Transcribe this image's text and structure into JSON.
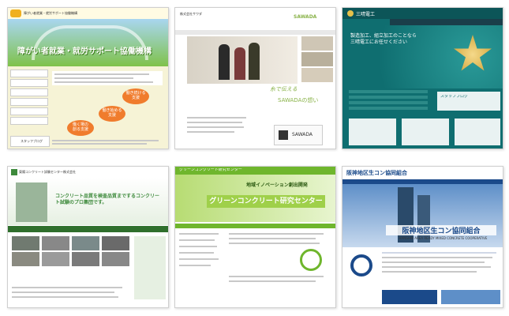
{
  "thumbs": [
    {
      "id": "t1",
      "header": "障がい者就業・就労サポート協働機構",
      "hero_title": "障がい者就業・就労サポート協働機構",
      "bubbles": [
        "働き続ける\n支援",
        "働き始める\n支援",
        "働く場の\n創る支援"
      ],
      "logo": "JS",
      "footer_text": "スタッフブログ",
      "colors": {
        "hero": "#8fc85a",
        "sky": "#a9d6f0",
        "bubble": "#f07c2d"
      }
    },
    {
      "id": "t2",
      "header": "株式会社サワダ",
      "brand": "SAWADA",
      "tagline": "糸で伝える",
      "tagline2": "SAWADAの想い",
      "colors": {
        "accent": "#8ab34a"
      }
    },
    {
      "id": "t3",
      "brand": "三晴電工",
      "headline": "製造加工、組立加工のことなら\n三晴電工にお任せください",
      "side_label": "スタッフブログ",
      "colors": {
        "bg": "#0f6e70",
        "nav": "#1a3e4a",
        "gold": "#e6c14a"
      }
    },
    {
      "id": "t4",
      "header": "東陽コンクリート試験センター株式会社",
      "headline": "コンクリート品質を検査品質までするコンクリート試験のプロ集団です。",
      "colors": {
        "green": "#3e8a3c",
        "nav": "#2f6f2c"
      }
    },
    {
      "id": "t5",
      "header": "グリーンコンクリート研究センター",
      "sub": "地域イノベーション創出開発",
      "banner": "グリーンコンクリート研究センター",
      "colors": {
        "green": "#6fb62d",
        "banner": "#9fd04a"
      }
    },
    {
      "id": "t6",
      "header": "阪神地区生コン協同組合",
      "banner": "阪神地区生コン協同組合",
      "banner_en": "HANSHIN AREA READY MIXED CONCRETE COOPERATIVE",
      "colors": {
        "blue": "#1b4a8a",
        "sky": "#5e8fc8"
      }
    }
  ]
}
